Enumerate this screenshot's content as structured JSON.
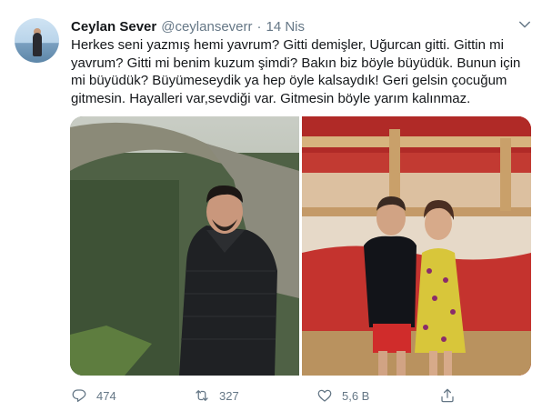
{
  "tweet": {
    "display_name": "Ceylan Sever",
    "handle": "@ceylanseverr",
    "separator": "·",
    "date": "14 Nis",
    "text": "Herkes seni yazmış hemi yavrum? Gitti demişler, Uğurcan gitti. Gittin mi yavrum? Gitti mi benim kuzum şimdi? Bakın biz böyle büyüdük. Bunun için mi büyüdük? Büyümeseydik ya hep öyle kalsaydık! Geri gelsin çocuğum gitmesin. Hayalleri var,sevdiği var. Gitmesin böyle yarım kalınmaz.",
    "media": [
      {
        "description_icon": "photo-man-jacket"
      },
      {
        "description_icon": "photo-children-bunkbed"
      }
    ]
  },
  "actions": {
    "reply_count": "474",
    "retweet_count": "327",
    "like_count": "5,6 B"
  },
  "colors": {
    "text": "#14171a",
    "muted": "#657786"
  }
}
